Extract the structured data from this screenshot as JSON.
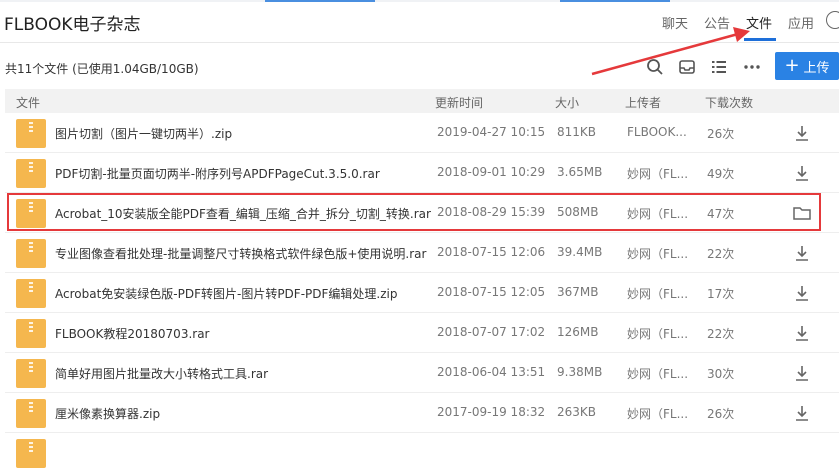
{
  "app": {
    "title": "FLBOOK电子杂志"
  },
  "nav": {
    "tabs": [
      {
        "label": "聊天",
        "active": false
      },
      {
        "label": "公告",
        "active": false
      },
      {
        "label": "文件",
        "active": true
      },
      {
        "label": "应用",
        "active": false
      }
    ],
    "accent_color": "#1e6fd9"
  },
  "toolbar": {
    "file_count": "共11个文件 (已使用1.04GB/10GB)",
    "icons": [
      "search-icon",
      "inbox-icon",
      "list-view-icon",
      "more-icon"
    ],
    "upload_label": "上传"
  },
  "table": {
    "columns": [
      "文件",
      "更新时间",
      "大小",
      "上传者",
      "下载次数"
    ],
    "rows": [
      {
        "name": "图片切割（图片一键切两半）.zip",
        "date": "2019-04-27 10:15",
        "size": "811KB",
        "uploader": "FLBOOK...",
        "downloads": "26次",
        "action": "download"
      },
      {
        "name": "PDF切割-批量页面切两半-附序列号APDFPageCut.3.5.0.rar",
        "date": "2018-09-01 10:29",
        "size": "3.65MB",
        "uploader": "妙网（FL...",
        "downloads": "49次",
        "action": "download"
      },
      {
        "name": "Acrobat_10安装版全能PDF查看_编辑_压缩_合并_拆分_切割_转换.rar",
        "date": "2018-08-29 15:39",
        "size": "508MB",
        "uploader": "妙网（FL...",
        "downloads": "47次",
        "action": "folder",
        "highlighted": true
      },
      {
        "name": "专业图像查看批处理-批量调整尺寸转换格式软件绿色版+使用说明.rar",
        "date": "2018-07-15 12:06",
        "size": "39.4MB",
        "uploader": "妙网（FL...",
        "downloads": "22次",
        "action": "download"
      },
      {
        "name": "Acrobat免安装绿色版-PDF转图片-图片转PDF-PDF编辑处理.zip",
        "date": "2018-07-15 12:05",
        "size": "367MB",
        "uploader": "妙网（FL...",
        "downloads": "17次",
        "action": "download"
      },
      {
        "name": "FLBOOK教程20180703.rar",
        "date": "2018-07-07 17:02",
        "size": "126MB",
        "uploader": "妙网（FL...",
        "downloads": "22次",
        "action": "download"
      },
      {
        "name": "简单好用图片批量改大小转格式工具.rar",
        "date": "2018-06-04 13:51",
        "size": "9.38MB",
        "uploader": "妙网（FL...",
        "downloads": "30次",
        "action": "download"
      },
      {
        "name": "厘米像素换算器.zip",
        "date": "2017-09-19 18:32",
        "size": "263KB",
        "uploader": "妙网（FL...",
        "downloads": "26次",
        "action": "download"
      }
    ]
  },
  "colors": {
    "highlight": "#e5393b",
    "file_icon": "#f5b74e",
    "button": "#2a82e4"
  }
}
